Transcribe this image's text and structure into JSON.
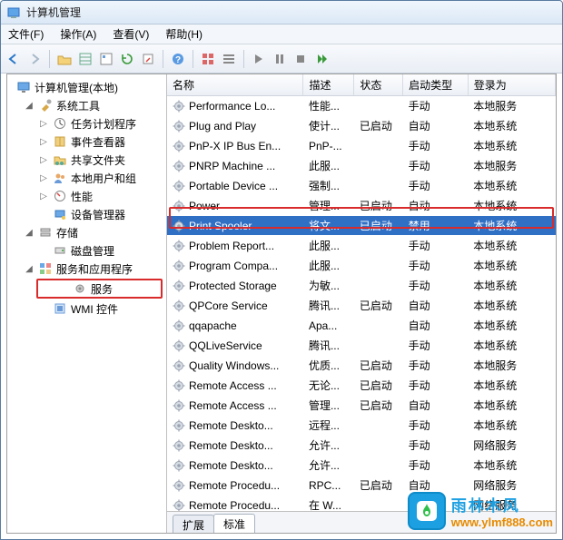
{
  "window": {
    "title": "计算机管理"
  },
  "menu": {
    "file": "文件(F)",
    "action": "操作(A)",
    "view": "查看(V)",
    "help": "帮助(H)"
  },
  "tree": {
    "root": "计算机管理(本地)",
    "sys_tools": "系统工具",
    "task_sched": "任务计划程序",
    "event_viewer": "事件查看器",
    "shared": "共享文件夹",
    "local_users": "本地用户和组",
    "perf": "性能",
    "devmgr": "设备管理器",
    "storage": "存储",
    "diskmgmt": "磁盘管理",
    "svc_app": "服务和应用程序",
    "services": "服务",
    "wmi": "WMI 控件"
  },
  "columns": {
    "name": "名称",
    "desc": "描述",
    "status": "状态",
    "startup": "启动类型",
    "logon": "登录为"
  },
  "tabs": {
    "ext": "扩展",
    "std": "标准"
  },
  "status_vals": {
    "started": "已启动"
  },
  "services": [
    {
      "name": "Performance Lo...",
      "desc": "性能...",
      "status": "",
      "startup": "手动",
      "logon": "本地服务"
    },
    {
      "name": "Plug and Play",
      "desc": "使计...",
      "status": "已启动",
      "startup": "自动",
      "logon": "本地系统"
    },
    {
      "name": "PnP-X IP Bus En...",
      "desc": "PnP-...",
      "status": "",
      "startup": "手动",
      "logon": "本地系统"
    },
    {
      "name": "PNRP Machine ...",
      "desc": "此服...",
      "status": "",
      "startup": "手动",
      "logon": "本地服务"
    },
    {
      "name": "Portable Device ...",
      "desc": "强制...",
      "status": "",
      "startup": "手动",
      "logon": "本地系统"
    },
    {
      "name": "Power",
      "desc": "管理...",
      "status": "已启动",
      "startup": "自动",
      "logon": "本地系统"
    },
    {
      "name": "Print Spooler",
      "desc": "将文...",
      "status": "已启动",
      "startup": "禁用",
      "logon": "本地系统",
      "selected": true
    },
    {
      "name": "Problem Report...",
      "desc": "此服...",
      "status": "",
      "startup": "手动",
      "logon": "本地系统"
    },
    {
      "name": "Program Compa...",
      "desc": "此服...",
      "status": "",
      "startup": "手动",
      "logon": "本地系统"
    },
    {
      "name": "Protected Storage",
      "desc": "为敏...",
      "status": "",
      "startup": "手动",
      "logon": "本地系统"
    },
    {
      "name": "QPCore Service",
      "desc": "腾讯...",
      "status": "已启动",
      "startup": "自动",
      "logon": "本地系统"
    },
    {
      "name": "qqapache",
      "desc": "Apa...",
      "status": "",
      "startup": "自动",
      "logon": "本地系统"
    },
    {
      "name": "QQLiveService",
      "desc": "腾讯...",
      "status": "",
      "startup": "手动",
      "logon": "本地系统"
    },
    {
      "name": "Quality Windows...",
      "desc": "优质...",
      "status": "已启动",
      "startup": "手动",
      "logon": "本地服务"
    },
    {
      "name": "Remote Access ...",
      "desc": "无论...",
      "status": "已启动",
      "startup": "手动",
      "logon": "本地系统"
    },
    {
      "name": "Remote Access ...",
      "desc": "管理...",
      "status": "已启动",
      "startup": "自动",
      "logon": "本地系统"
    },
    {
      "name": "Remote Deskto...",
      "desc": "远程...",
      "status": "",
      "startup": "手动",
      "logon": "本地系统"
    },
    {
      "name": "Remote Deskto...",
      "desc": "允许...",
      "status": "",
      "startup": "手动",
      "logon": "网络服务"
    },
    {
      "name": "Remote Deskto...",
      "desc": "允许...",
      "status": "",
      "startup": "手动",
      "logon": "本地系统"
    },
    {
      "name": "Remote Procedu...",
      "desc": "RPC...",
      "status": "已启动",
      "startup": "自动",
      "logon": "网络服务"
    },
    {
      "name": "Remote Procedu...",
      "desc": "在 W...",
      "status": "",
      "startup": "手动",
      "logon": "网络服务"
    }
  ],
  "watermark": {
    "cn": "雨林木风",
    "url": "www.ylmf888.com"
  }
}
